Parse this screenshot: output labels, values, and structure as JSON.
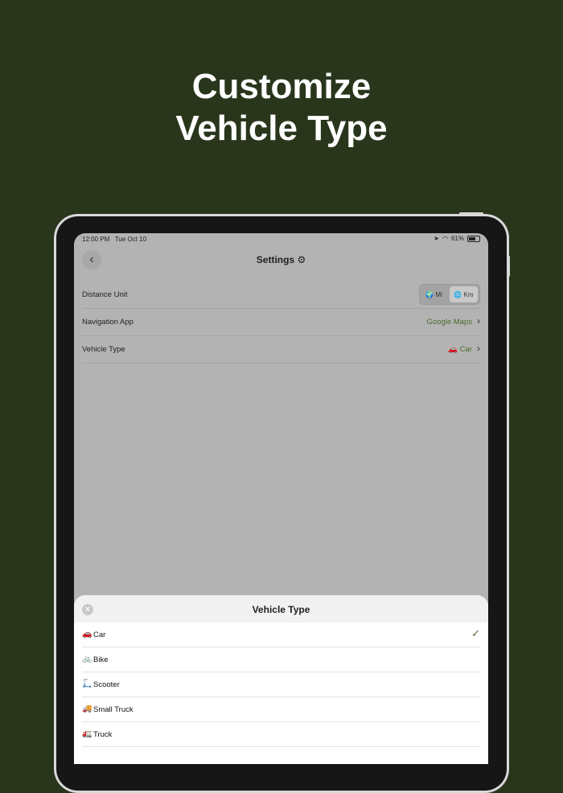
{
  "headline": {
    "line1": "Customize",
    "line2": "Vehicle Type"
  },
  "status_bar": {
    "time": "12:00 PM",
    "date": "Tue Oct 10",
    "battery": "61%"
  },
  "settings": {
    "title": "Settings ⚙",
    "rows": [
      {
        "label": "Distance Unit",
        "segments": [
          {
            "icon": "🌍",
            "label": "Mi"
          },
          {
            "icon": "🌐",
            "label": "Km"
          }
        ],
        "selected": "Km"
      },
      {
        "label": "Navigation App",
        "value": "Google Maps"
      },
      {
        "label": "Vehicle Type",
        "value": "🚗 Car"
      }
    ]
  },
  "sheet": {
    "title": "Vehicle Type",
    "options": [
      {
        "icon": "🚗",
        "label": "Car",
        "selected": true
      },
      {
        "icon": "🚲",
        "label": "Bike",
        "selected": false
      },
      {
        "icon": "🛴",
        "label": "Scooter",
        "selected": false
      },
      {
        "icon": "🚚",
        "label": "Small Truck",
        "selected": false
      },
      {
        "icon": "🚛",
        "label": "Truck",
        "selected": false
      }
    ]
  },
  "colors": {
    "background": "#29361c",
    "accent": "#4c6a2b"
  }
}
